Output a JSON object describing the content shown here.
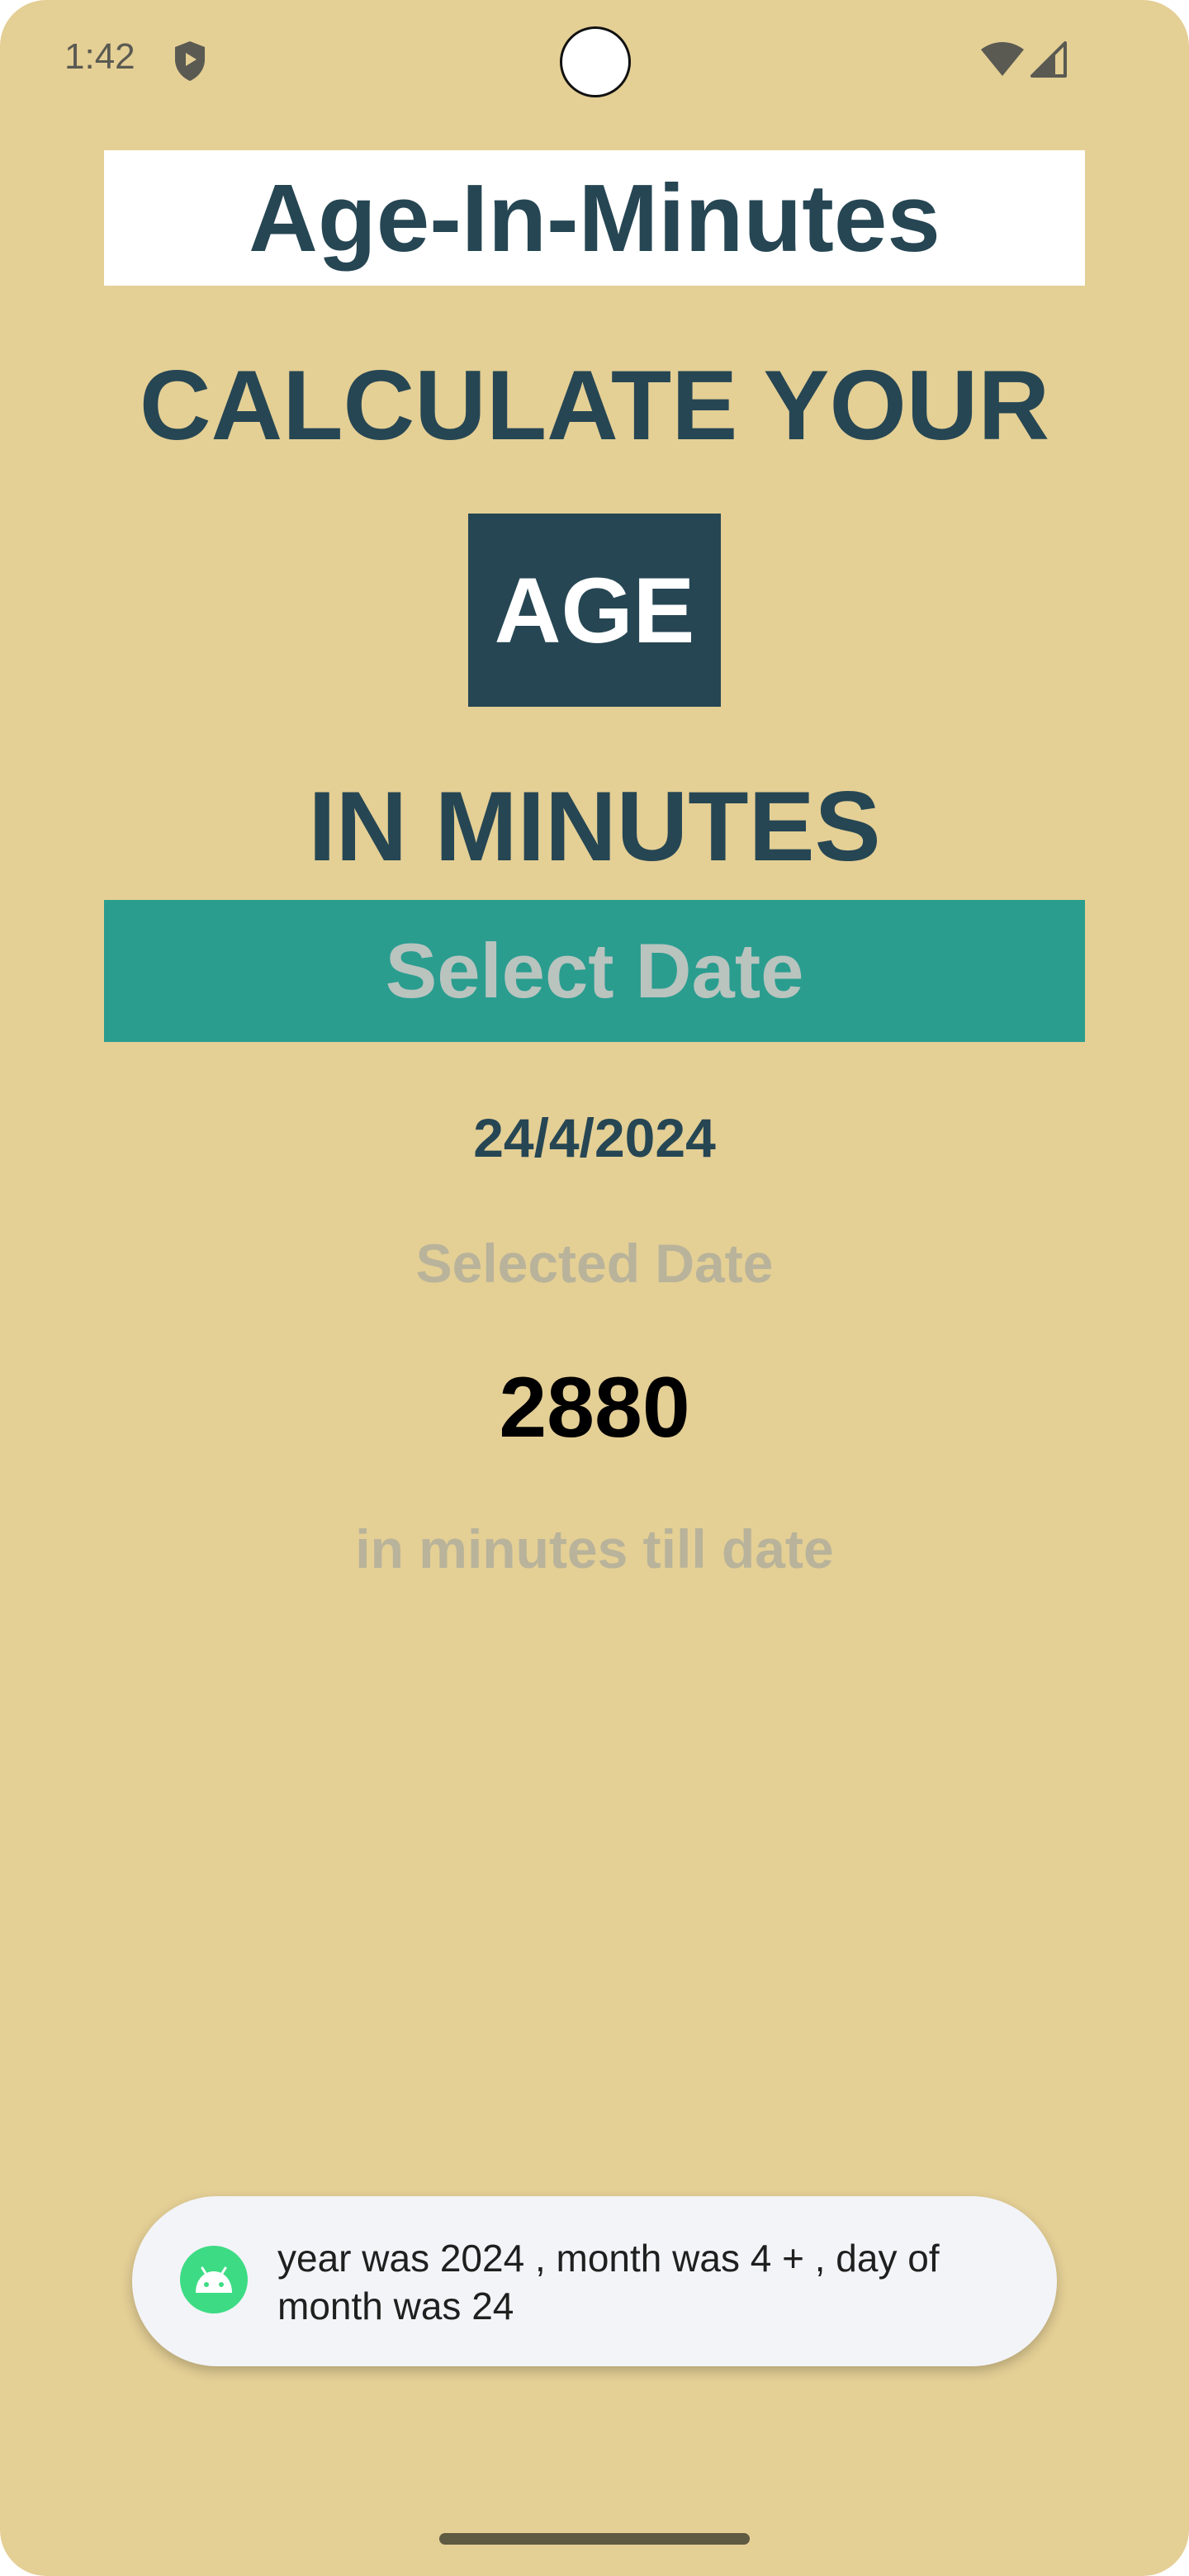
{
  "status_bar": {
    "time": "1:42",
    "icons": [
      "shield-icon",
      "wifi-icon",
      "cellular-signal-icon"
    ]
  },
  "app": {
    "title": "Age-In-Minutes",
    "heading_line1": "CALCULATE YOUR",
    "heading_line2": "AGE",
    "heading_line3": "IN MINUTES",
    "select_button_label": "Select Date",
    "selected_date_value": "24/4/2024",
    "selected_date_label": "Selected Date",
    "minutes_value": "2880",
    "minutes_label": "in minutes till date"
  },
  "toast": {
    "icon": "android-icon",
    "message": "year was 2024 , month was 4 + , day of month was 24"
  },
  "colors": {
    "background": "#e4cf95",
    "primary_dark": "#264653",
    "button": "#2a9d8f",
    "muted_text": "#b8b39a"
  }
}
